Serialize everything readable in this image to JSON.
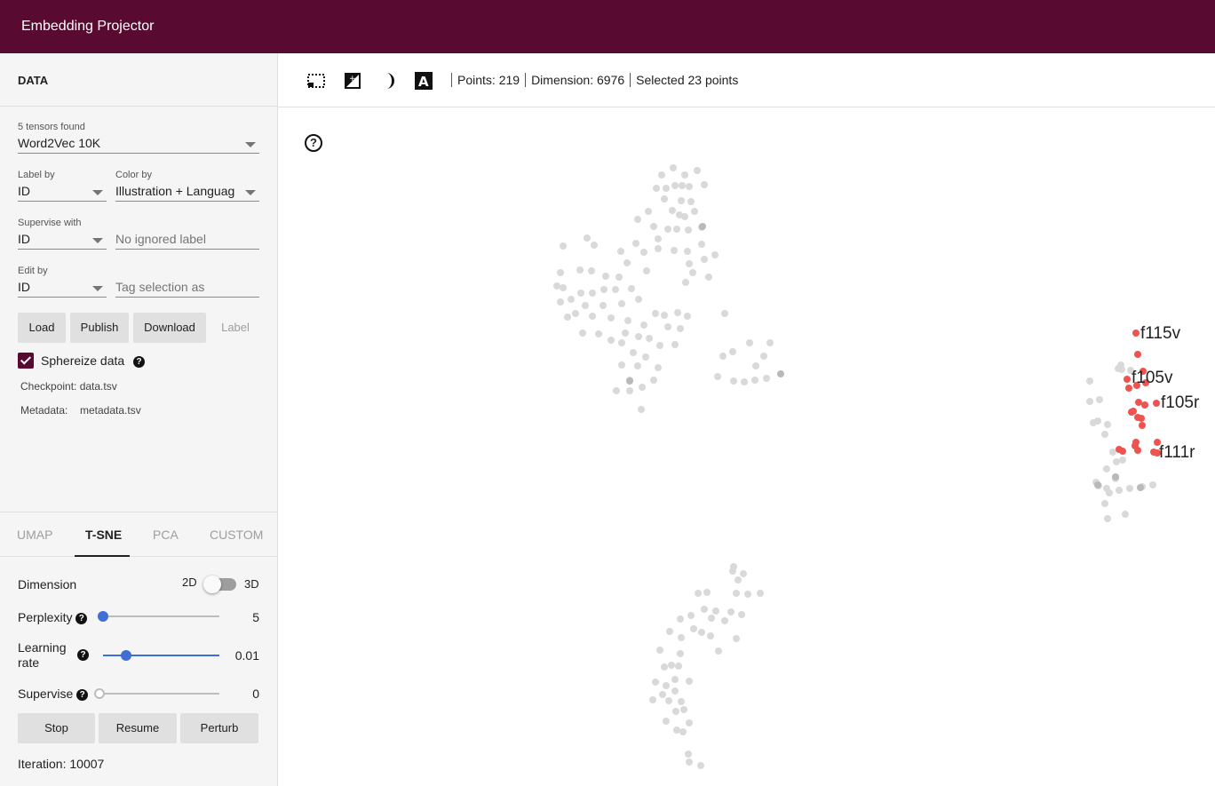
{
  "app": {
    "title": "Embedding Projector"
  },
  "data_panel": {
    "title": "DATA",
    "tensors_label": "5 tensors found",
    "tensor_value": "Word2Vec 10K",
    "label_by": {
      "label": "Label by",
      "value": "ID"
    },
    "color_by": {
      "label": "Color by",
      "value": "Illustration + Languag"
    },
    "supervise_with": {
      "label": "Supervise with",
      "value": "ID"
    },
    "ignored_label_placeholder": "No ignored label",
    "edit_by": {
      "label": "Edit by",
      "value": "ID"
    },
    "tag_placeholder": "Tag selection as",
    "buttons": {
      "load": "Load",
      "publish": "Publish",
      "download": "Download",
      "label": "Label"
    },
    "sphereize": {
      "label": "Sphereize data",
      "checked": true
    },
    "checkpoint": "Checkpoint: data.tsv",
    "metadata_key": "Metadata:",
    "metadata_value": "metadata.tsv"
  },
  "projection": {
    "tabs": [
      "UMAP",
      "T-SNE",
      "PCA",
      "CUSTOM"
    ],
    "active_tab": "T-SNE",
    "dimension": {
      "label": "Dimension",
      "opt_2d": "2D",
      "opt_3d": "3D"
    },
    "perplexity": {
      "label": "Perplexity",
      "value": "5"
    },
    "learning_rate": {
      "label_1": "Learning",
      "label_2": "rate",
      "value": "0.01"
    },
    "supervise": {
      "label": "Supervise",
      "value": "0"
    },
    "buttons": {
      "stop": "Stop",
      "resume": "Resume",
      "perturb": "Perturb"
    },
    "iteration": "Iteration: 10007"
  },
  "toolbar": {
    "points": "Points: 219",
    "dimension": "Dimension: 6976",
    "selected": "Selected 23 points"
  },
  "scatter": {
    "labels": [
      "f115v",
      "f105v",
      "f105r",
      "f111r"
    ],
    "colors": {
      "selected": "#ef5350",
      "unselected": "#d9d9d9",
      "accent": "#590a30"
    }
  }
}
